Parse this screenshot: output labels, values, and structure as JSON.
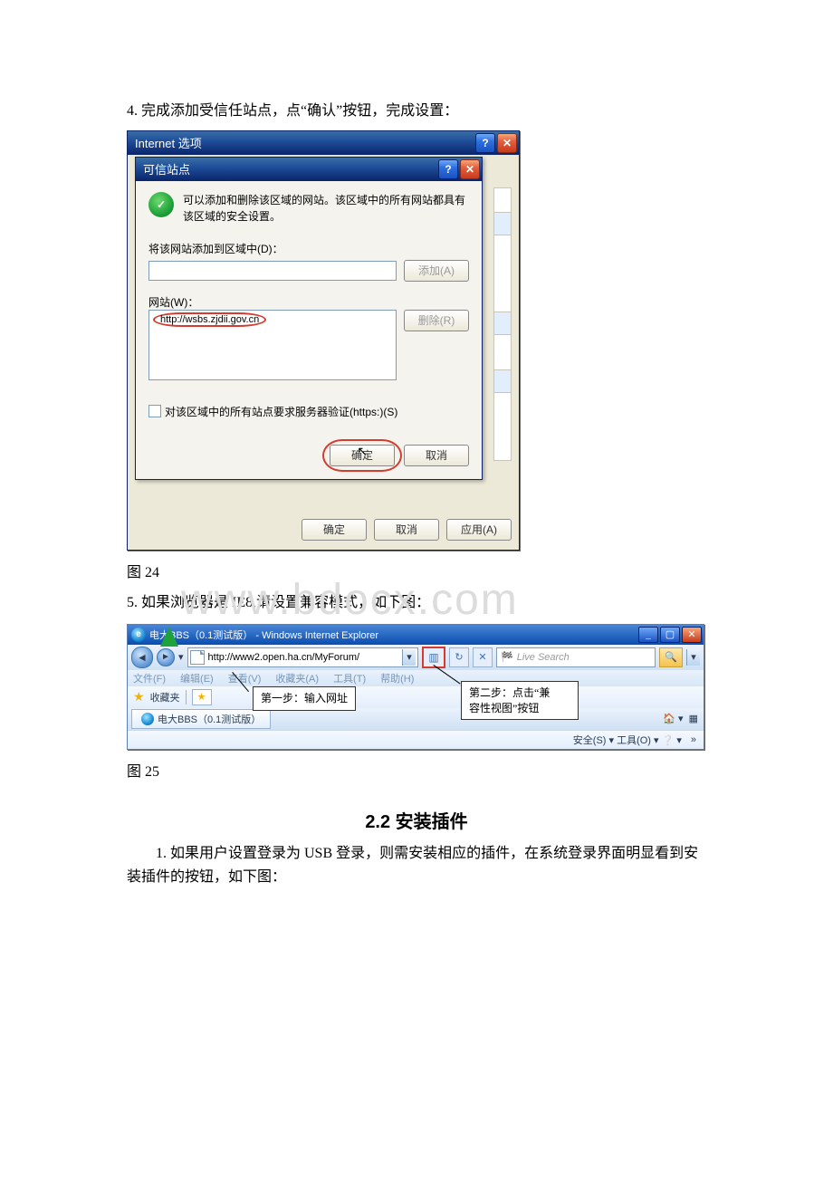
{
  "step4_text": "4. 完成添加受信任站点，点“确认”按钮，完成设置：",
  "io": {
    "title": "Internet 选项",
    "buttons": {
      "ok": "确定",
      "cancel": "取消",
      "apply": "应用(A)"
    }
  },
  "ts": {
    "title": "可信站点",
    "desc": "可以添加和删除该区域的网站。该区域中的所有网站都具有该区域的安全设置。",
    "add_label": "将该网站添加到区域中(D)：",
    "add_btn": "添加(A)",
    "sites_label": "网站(W)：",
    "remove_btn": "删除(R)",
    "list_url": "http://wsbs.zjdii.gov.cn",
    "require_https": "对该区域中的所有站点要求服务器验证(https:)(S)",
    "ok": "确定",
    "cancel": "取消"
  },
  "fig24": "图 24",
  "watermark": "www.bdocx.com",
  "step5_text": "5. 如果浏览器是 IE8,请设置兼容模式，如下图：",
  "ie8": {
    "title": "电大BBS（0.1测试版） - Windows Internet Explorer",
    "url": "http://www2.open.ha.cn/MyForum/",
    "search_placeholder": "Live Search",
    "menu": [
      "文件(F)",
      "编辑(E)",
      "查看(V)",
      "收藏夹(A)",
      "工具(T)",
      "帮助(H)"
    ],
    "fav_label": "收藏夹",
    "tab_label": "电大BBS（0.1测试版）",
    "status_right": "安全(S) ▾   工具(O) ▾   ❔ ▾",
    "callout1": "第一步：输入网址",
    "callout2_l1": "第二步：点击“兼",
    "callout2_l2": "容性视图”按钮"
  },
  "fig25": "图 25",
  "section22": "2.2  安装插件",
  "sec22_para": "1. 如果用户设置登录为 USB 登录，则需安装相应的插件，在系统登录界面明显看到安装插件的按钮，如下图："
}
